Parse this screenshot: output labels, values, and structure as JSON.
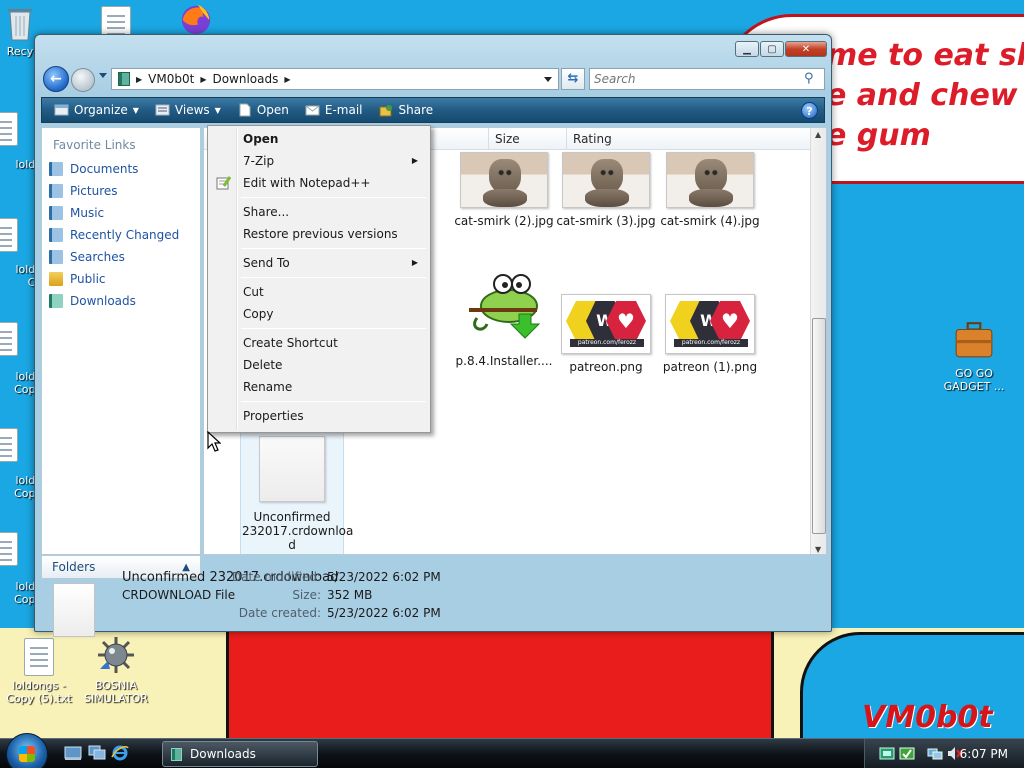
{
  "wallpaper": {
    "bubble_text": "me to eat shit\ne and chew\ne gum",
    "signature": "VM0b0t"
  },
  "desktop_icons": {
    "recycle": "Recy",
    "left_labels": [
      "loldo",
      "loldo\nCo",
      "loldo\nCopy",
      "loldo\nCopy",
      "loldo\nCopy"
    ],
    "loldongs": "loldongs -\nCopy (5).txt",
    "bosnia": "BOSNIA\nSIMULATOR",
    "gadget": "GO GO\nGADGET ..."
  },
  "window": {
    "address": [
      "VM0b0t",
      "Downloads"
    ],
    "search_placeholder": "Search"
  },
  "toolbar": {
    "organize": "Organize",
    "views": "Views",
    "open": "Open",
    "email": "E-mail",
    "share": "Share"
  },
  "nav": {
    "title": "Favorite Links",
    "links": [
      "Documents",
      "Pictures",
      "Music",
      "Recently Changed",
      "Searches",
      "Public",
      "Downloads"
    ],
    "folders": "Folders"
  },
  "columns": {
    "size": "Size",
    "rating": "Rating"
  },
  "files": {
    "cat2": "cat-smirk (2).jpg",
    "cat3": "cat-smirk (3).jpg",
    "cat4": "cat-smirk (4).jpg",
    "installer": "p.8.4.Installer....",
    "patreon": "patreon.png",
    "patreon1": "patreon (1).png",
    "unconfirmed": "Unconfirmed\n232017.crdownloa\nd",
    "patreon_caption": "patreon.com/ferozz"
  },
  "context_menu": {
    "open": "Open",
    "seven_zip": "7-Zip",
    "edit_npp": "Edit with Notepad++",
    "share": "Share...",
    "restore": "Restore previous versions",
    "send_to": "Send To",
    "cut": "Cut",
    "copy": "Copy",
    "create_shortcut": "Create Shortcut",
    "delete": "Delete",
    "rename": "Rename",
    "properties": "Properties"
  },
  "details": {
    "name": "Unconfirmed 232017.crdownload",
    "type": "CRDOWNLOAD File",
    "date_modified_label": "Date modified:",
    "date_modified": "5/23/2022 6:02 PM",
    "size_label": "Size:",
    "size": "352 MB",
    "date_created_label": "Date created:",
    "date_created": "5/23/2022 6:02 PM"
  },
  "taskbar": {
    "task": "Downloads",
    "time": "6:07 PM"
  }
}
